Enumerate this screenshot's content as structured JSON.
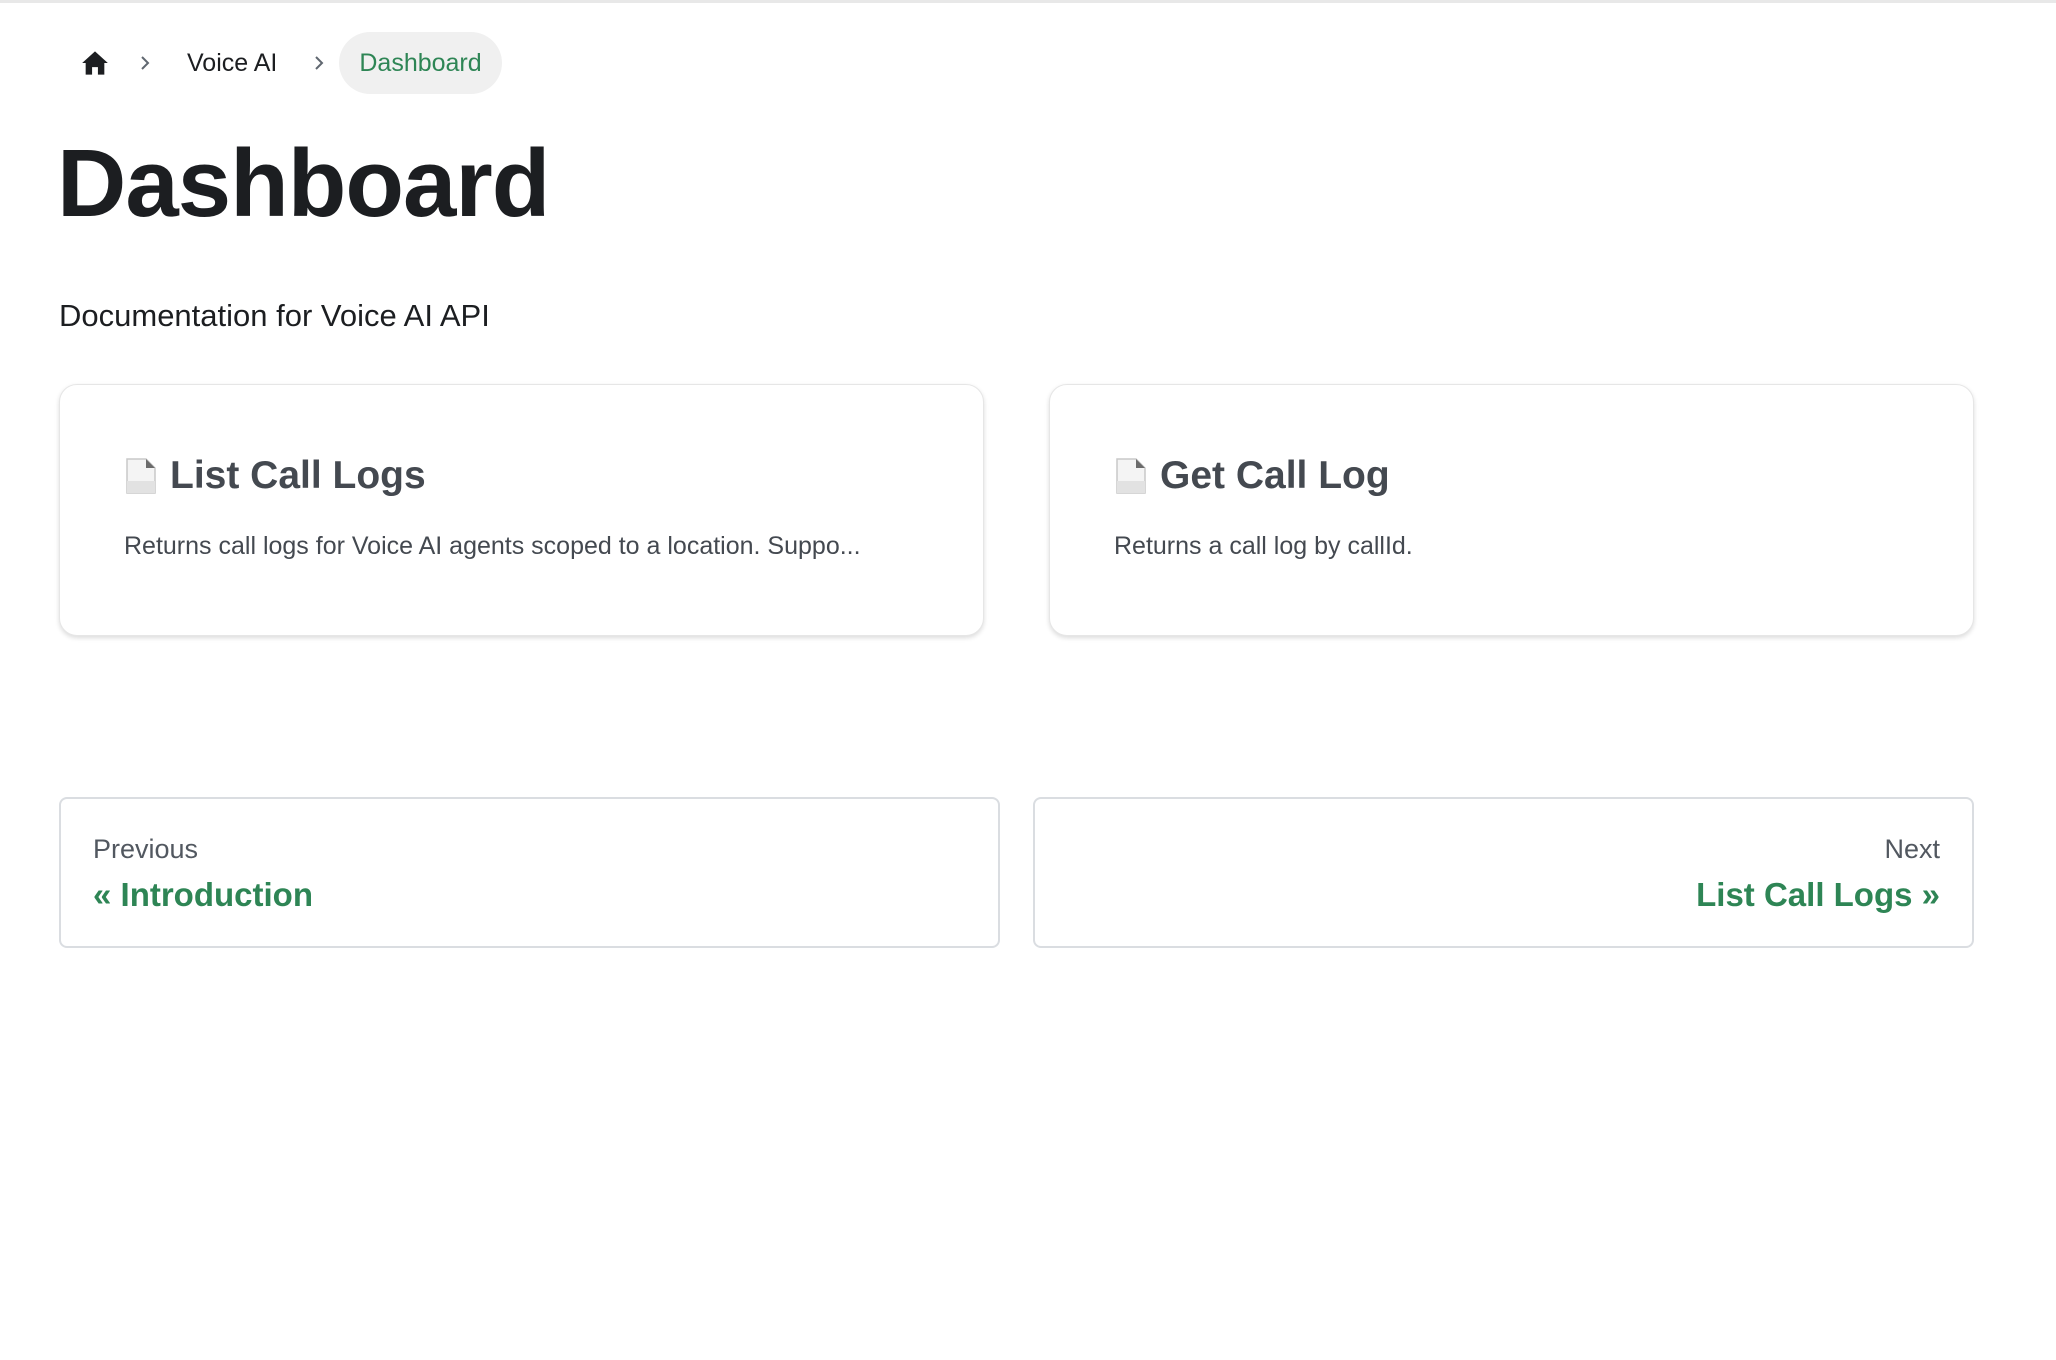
{
  "breadcrumb": {
    "home_icon": "home-icon",
    "separator_icon": "chevron-right-icon",
    "items": [
      "Voice AI"
    ],
    "active": "Dashboard"
  },
  "page": {
    "title": "Dashboard",
    "description": "Documentation for Voice AI API"
  },
  "cards": [
    {
      "icon": "document-icon",
      "title": "List Call Logs",
      "description": "Returns call logs for Voice AI agents scoped to a location. Suppo..."
    },
    {
      "icon": "document-icon",
      "title": "Get Call Log",
      "description": "Returns a call log by callId."
    }
  ],
  "pagination": {
    "previous": {
      "sublabel": "Previous",
      "label": "« Introduction"
    },
    "next": {
      "sublabel": "Next",
      "label": "List Call Logs »"
    }
  },
  "colors": {
    "accent": "#2e8555",
    "text": "#1c1e21",
    "card_text": "#444950",
    "active_crumb_bg": "#f0f0f0"
  }
}
